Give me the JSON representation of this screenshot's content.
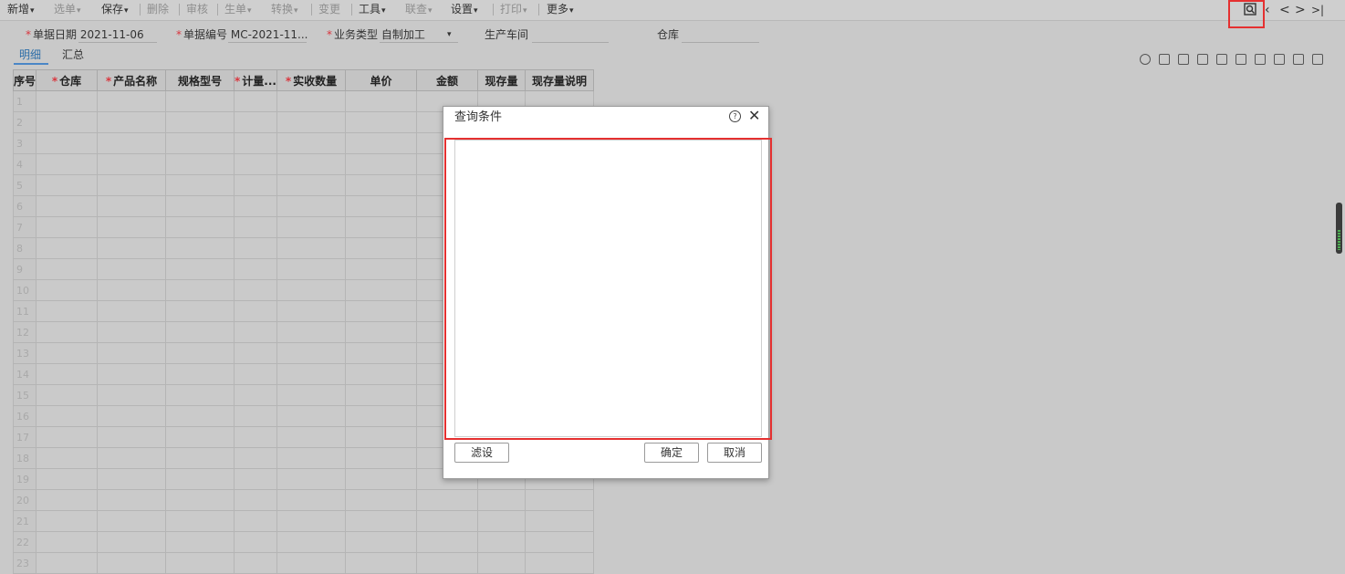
{
  "toolbar": {
    "menus": [
      {
        "label": "新增",
        "enabled": true
      },
      {
        "label": "选单",
        "enabled": false
      },
      {
        "label": "保存",
        "enabled": true
      },
      {
        "label": "删除",
        "enabled": false
      },
      {
        "label": "审核",
        "enabled": false
      },
      {
        "label": "生单",
        "enabled": false
      },
      {
        "label": "转换",
        "enabled": false
      },
      {
        "label": "变更",
        "enabled": false
      },
      {
        "label": "工具",
        "enabled": true
      },
      {
        "label": "联查",
        "enabled": false
      },
      {
        "label": "设置",
        "enabled": true
      },
      {
        "label": "打印",
        "enabled": false
      },
      {
        "label": "更多",
        "enabled": true
      }
    ],
    "nav_icons": [
      "query-icon",
      "first-icon",
      "prev-icon",
      "next-icon",
      "last-icon"
    ]
  },
  "form": {
    "date": {
      "label": "单据日期",
      "value": "2021-11-06"
    },
    "number": {
      "label": "单据编号",
      "value": "MC-2021-11..."
    },
    "biz_type": {
      "label": "业务类型",
      "value": "自制加工"
    },
    "workshop": {
      "label": "生产车间",
      "value": ""
    },
    "warehouse": {
      "label": "仓库",
      "value": ""
    }
  },
  "tabs": [
    {
      "label": "明细",
      "active": true
    },
    {
      "label": "汇总",
      "active": false
    }
  ],
  "table": {
    "headers": [
      {
        "label": "序号",
        "required": false
      },
      {
        "label": "仓库",
        "required": true
      },
      {
        "label": "产品名称",
        "required": true
      },
      {
        "label": "规格型号",
        "required": false
      },
      {
        "label": "计量...",
        "required": true
      },
      {
        "label": "实收数量",
        "required": true
      },
      {
        "label": "单价",
        "required": false
      },
      {
        "label": "金额",
        "required": false
      },
      {
        "label": "现存量",
        "required": false
      },
      {
        "label": "现存量说明",
        "required": false
      }
    ],
    "row_numbers": [
      "1",
      "2",
      "3",
      "4",
      "5",
      "6",
      "7",
      "8",
      "9",
      "10",
      "11",
      "12",
      "13",
      "14",
      "15",
      "16",
      "17",
      "18",
      "19",
      "20",
      "21",
      "22",
      "23"
    ]
  },
  "dialog": {
    "title": "查询条件",
    "help": "?",
    "close": "✕",
    "filter_btn": "滤设",
    "ok_btn": "确定",
    "cancel_btn": "取消"
  },
  "colors": {
    "highlight": "#e53030",
    "accent": "#2d6ea8",
    "required": "#d9363e"
  }
}
